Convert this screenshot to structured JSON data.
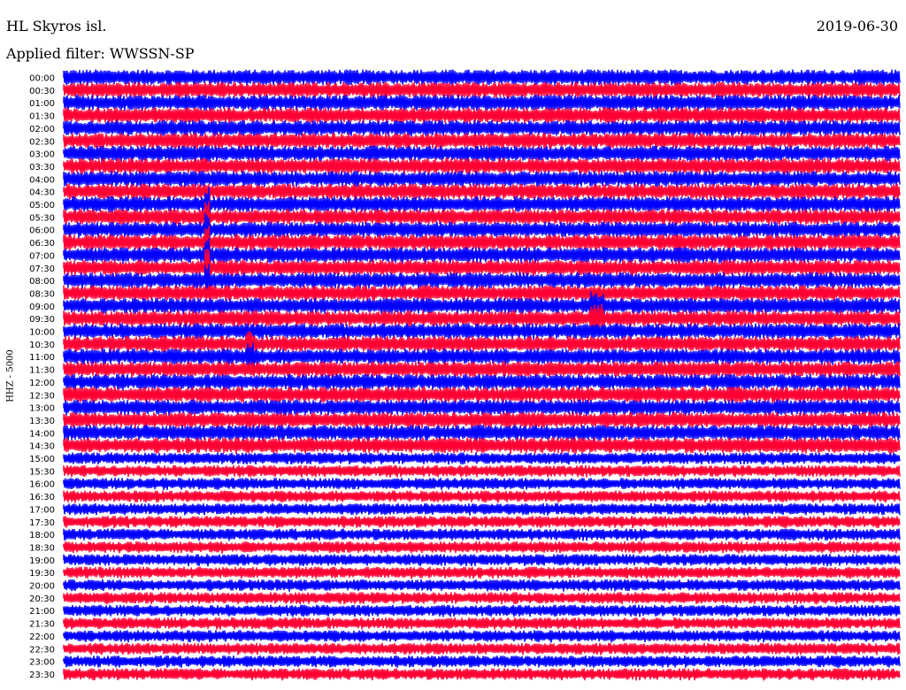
{
  "header": {
    "title": "HL Skyros isl.",
    "date": "2019-06-30",
    "filter": "Applied filter: WWSSN-SP"
  },
  "chart_data": {
    "type": "line",
    "title": "HL Skyros isl.",
    "ylabel": "HHZ - 5000",
    "row_labels": [
      "00:00",
      "00:30",
      "01:00",
      "01:30",
      "02:00",
      "02:30",
      "03:00",
      "03:30",
      "04:00",
      "04:30",
      "05:00",
      "05:30",
      "06:00",
      "06:30",
      "07:00",
      "07:30",
      "08:00",
      "08:30",
      "09:00",
      "09:30",
      "10:00",
      "10:30",
      "11:00",
      "11:30",
      "12:00",
      "12:30",
      "13:00",
      "13:30",
      "14:00",
      "14:30",
      "15:00",
      "15:30",
      "16:00",
      "16:30",
      "17:00",
      "17:30",
      "18:00",
      "18:30",
      "19:00",
      "19:30",
      "20:00",
      "20:30",
      "21:00",
      "21:30",
      "22:00",
      "22:30",
      "23:00",
      "23:30"
    ],
    "series_colors": [
      "#0000ff",
      "#ff0033"
    ],
    "grid": false
  }
}
